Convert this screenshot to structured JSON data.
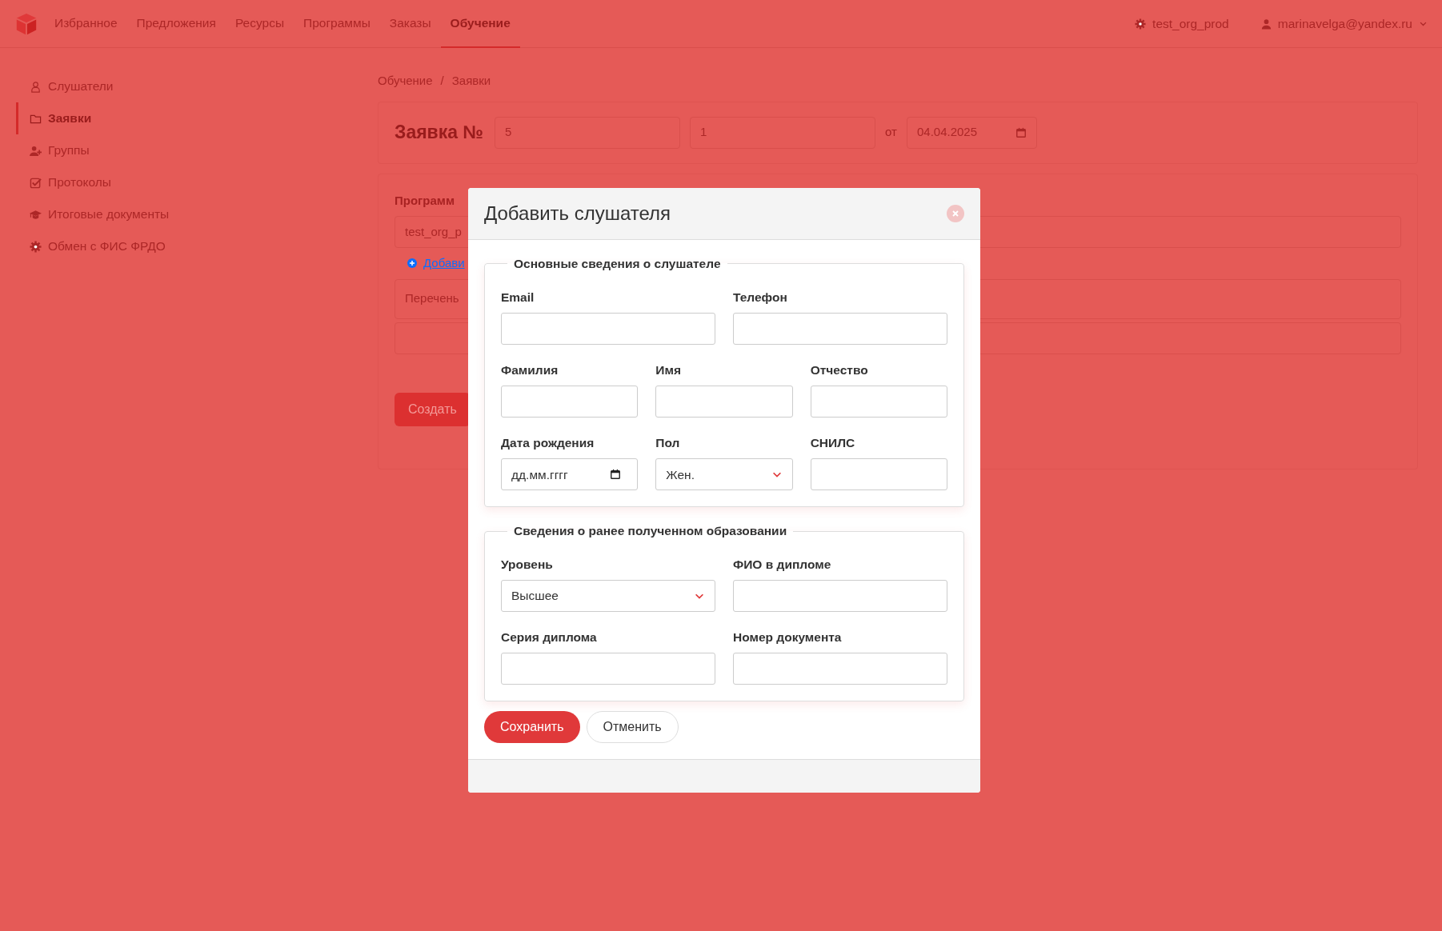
{
  "navbar": {
    "items": [
      {
        "label": "Избранное",
        "selected": false
      },
      {
        "label": "Предложения",
        "selected": false
      },
      {
        "label": "Ресурсы",
        "selected": false
      },
      {
        "label": "Программы",
        "selected": false
      },
      {
        "label": "Заказы",
        "selected": false
      },
      {
        "label": "Обучение",
        "selected": true
      }
    ],
    "org": "test_org_prod",
    "user": "marinavelga@yandex.ru"
  },
  "sidebar": {
    "items": [
      {
        "label": "Слушатели",
        "kind": "person",
        "selected": false
      },
      {
        "label": "Заявки",
        "kind": "folder",
        "selected": true
      },
      {
        "label": "Группы",
        "kind": "user-plus",
        "selected": false
      },
      {
        "label": "Протоколы",
        "kind": "check",
        "selected": false
      },
      {
        "label": "Итоговые документы",
        "kind": "graduation",
        "selected": false
      },
      {
        "label": "Обмен с ФИС ФРДО",
        "kind": "gear",
        "selected": false
      }
    ]
  },
  "breadcrumb": {
    "items": [
      "Обучение",
      "Заявки"
    ],
    "separator": "/"
  },
  "request": {
    "title": "Заявка №",
    "number": "5",
    "suffix": "1",
    "date_prefix": "от",
    "date": "04.04.2025"
  },
  "program": {
    "label": "Программ",
    "value": "test_org_p",
    "add_link": "Добави",
    "list_placeholder": "Перечень",
    "create_button": "Создать"
  },
  "modal": {
    "title": "Добавить слушателя",
    "sections": [
      {
        "legend": "Основные сведения о слушателе",
        "rows": [
          [
            {
              "label": "Email",
              "kind": "text"
            },
            {
              "label": "Телефон",
              "kind": "text"
            }
          ],
          [
            {
              "label": "Фамилия",
              "kind": "text"
            },
            {
              "label": "Имя",
              "kind": "text"
            },
            {
              "label": "Отчество",
              "kind": "text"
            }
          ],
          [
            {
              "label": "Дата рождения",
              "kind": "date",
              "placeholder": "дд.мм.гггг"
            },
            {
              "label": "Пол",
              "kind": "select",
              "value": "Жен."
            },
            {
              "label": "СНИЛС",
              "kind": "text"
            }
          ]
        ]
      },
      {
        "legend": "Сведения о ранее полученном образовании",
        "rows": [
          [
            {
              "label": "Уровень",
              "kind": "select",
              "value": "Высшее"
            },
            {
              "label": "ФИО в дипломе",
              "kind": "text"
            }
          ],
          [
            {
              "label": "Серия диплома",
              "kind": "text"
            },
            {
              "label": "Номер документа",
              "kind": "text"
            }
          ]
        ]
      }
    ],
    "buttons": [
      {
        "label": "Сохранить",
        "kind": "primary"
      },
      {
        "label": "Отменить",
        "kind": "secondary"
      }
    ]
  }
}
